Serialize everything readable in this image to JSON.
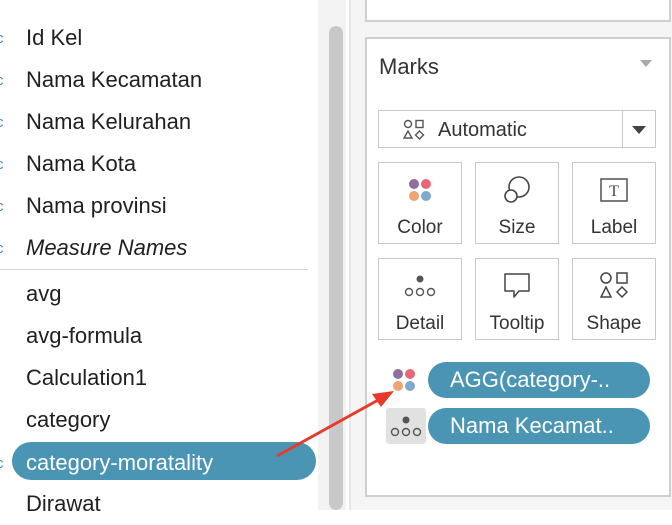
{
  "data_pane": {
    "dimensions": [
      {
        "type": "Abc",
        "label": "Id Kel"
      },
      {
        "type": "Abc",
        "label": "Nama Kecamatan"
      },
      {
        "type": "Abc",
        "label": "Nama Kelurahan"
      },
      {
        "type": "Abc",
        "label": "Nama Kota"
      },
      {
        "type": "Abc",
        "label": "Nama provinsi"
      },
      {
        "type": "Abc",
        "label": "Measure Names"
      }
    ],
    "measures": [
      {
        "type": "",
        "label": "avg"
      },
      {
        "type": "",
        "label": "avg-formula"
      },
      {
        "type": "",
        "label": "Calculation1"
      },
      {
        "type": "",
        "label": "category"
      },
      {
        "type": "Abc",
        "label": "category-moratality",
        "selected": true
      },
      {
        "type": "",
        "label": "Dirawat"
      }
    ],
    "type_glyph": "c"
  },
  "marks": {
    "title": "Marks",
    "mark_type": "Automatic",
    "buttons": [
      {
        "label": "Color",
        "icon": "color-dots-icon"
      },
      {
        "label": "Size",
        "icon": "size-circles-icon"
      },
      {
        "label": "Label",
        "icon": "text-t-icon"
      },
      {
        "label": "Detail",
        "icon": "detail-dots-icon"
      },
      {
        "label": "Tooltip",
        "icon": "speech-bubble-icon"
      },
      {
        "label": "Shape",
        "icon": "shapes-icon"
      }
    ],
    "pills": [
      {
        "label": "AGG(category-..",
        "encoding": "color"
      },
      {
        "label": "Nama Kecamat..",
        "encoding": "detail"
      }
    ]
  },
  "colors": {
    "accent": "#4a95b4",
    "arrow": "#e8392b",
    "dot_purple": "#8e6f9e",
    "dot_red": "#e8667a",
    "dot_orange": "#f0a270",
    "dot_blue": "#7fa8d0"
  }
}
